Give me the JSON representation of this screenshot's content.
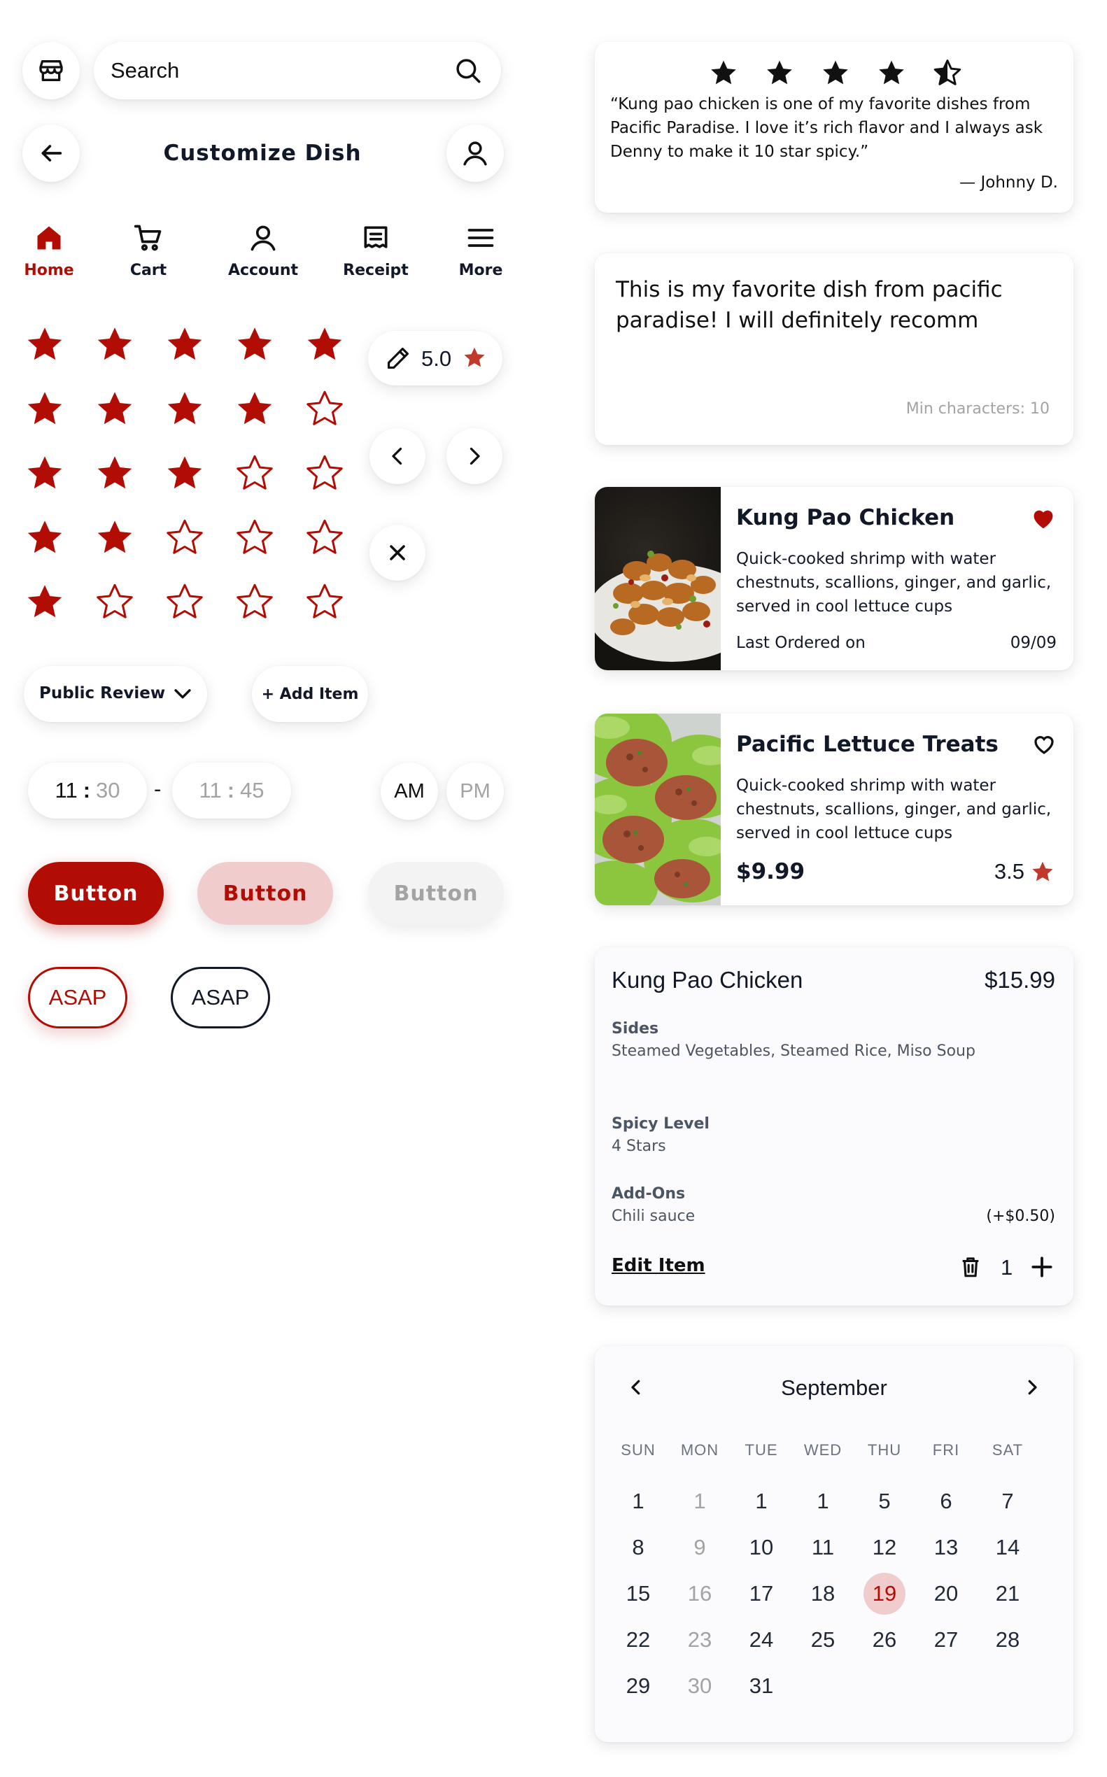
{
  "search": {
    "placeholder": "Search"
  },
  "header": {
    "title": "Customize Dish"
  },
  "nav": [
    {
      "label": "Home",
      "icon": "home-icon",
      "active": true
    },
    {
      "label": "Cart",
      "icon": "cart-icon",
      "active": false
    },
    {
      "label": "Account",
      "icon": "account-icon",
      "active": false
    },
    {
      "label": "Receipt",
      "icon": "receipt-icon",
      "active": false
    },
    {
      "label": "More",
      "icon": "menu-icon",
      "active": false
    }
  ],
  "star_rows": [
    5,
    4,
    3,
    2,
    1
  ],
  "rating_edit": {
    "value": "5.0"
  },
  "dropdown": {
    "label": "Public Review"
  },
  "add_item": {
    "label": "+ Add Item"
  },
  "time_range": {
    "start_h": "11",
    "start_m": "30",
    "sep": "-",
    "end_h": "11",
    "end_m": "45"
  },
  "ampm": {
    "am": "AM",
    "pm": "PM",
    "selected": "AM"
  },
  "buttons": {
    "primary": "Button",
    "secondary": "Button",
    "disabled": "Button"
  },
  "chips": {
    "asap_red": "ASAP",
    "asap_dark": "ASAP"
  },
  "testimonial": {
    "rating": 4.5,
    "quote": "“Kung pao chicken is one of my favorite dishes from Pacific Paradise. I love it’s rich flavor and I always ask Denny to make it 10 star spicy.”",
    "author": "— Johnny D."
  },
  "review_input": {
    "text": "This is my favorite dish from pacific paradise! I will definitely recomm",
    "hint": "Min characters: 10"
  },
  "dish_cards": [
    {
      "title": "Kung Pao Chicken",
      "desc": "Quick-cooked shrimp with water chestnuts, scallions, ginger, and garlic, served in cool lettuce cups",
      "footer_left": "Last Ordered on",
      "footer_right": "09/09",
      "favorite": true
    },
    {
      "title": "Pacific Lettuce Treats",
      "desc": "Quick-cooked shrimp with water chestnuts, scallions, ginger, and garlic, served in cool lettuce cups",
      "price": "$9.99",
      "rating": "3.5",
      "favorite": false
    }
  ],
  "order": {
    "title": "Kung Pao Chicken",
    "price": "$15.99",
    "sides_label": "Sides",
    "sides_value": "Steamed Vegetables, Steamed Rice, Miso Soup",
    "spicy_label": "Spicy Level",
    "spicy_value": "4 Stars",
    "addons_label": "Add-Ons",
    "addons_value": "Chili sauce",
    "addons_price": "(+$0.50)",
    "edit_label": "Edit Item",
    "quantity": "1"
  },
  "calendar": {
    "month": "September",
    "weekdays": [
      "SUN",
      "MON",
      "TUE",
      "WED",
      "THU",
      "FRI",
      "SAT"
    ],
    "weeks": [
      [
        "1",
        "1",
        "1",
        "1",
        "5",
        "6",
        "7"
      ],
      [
        "8",
        "9",
        "10",
        "11",
        "12",
        "13",
        "14"
      ],
      [
        "15",
        "16",
        "17",
        "18",
        "19",
        "20",
        "21"
      ],
      [
        "22",
        "23",
        "24",
        "25",
        "26",
        "27",
        "28"
      ],
      [
        "29",
        "30",
        "31",
        "",
        "",
        "",
        ""
      ]
    ],
    "muted_column": 1,
    "selected": "19"
  },
  "colors": {
    "accent": "#b10d04",
    "accent_light": "#f0cccd",
    "star_gold": "#c0392b",
    "dark": "#111827",
    "muted": "#a3a3a3"
  }
}
